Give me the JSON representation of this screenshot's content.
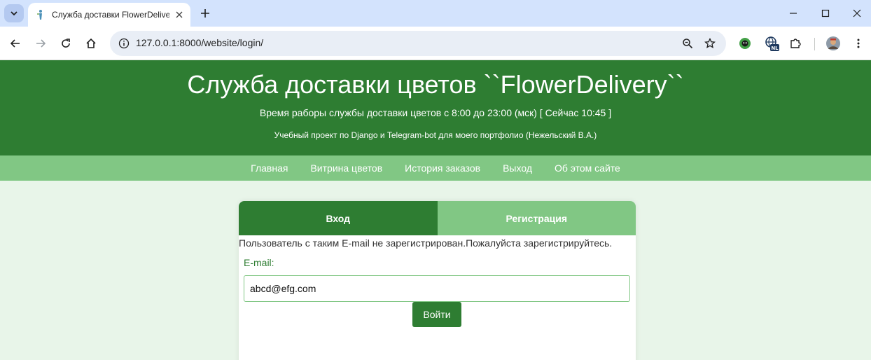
{
  "browser": {
    "tab_title": "Служба доставки FlowerDelivery",
    "url": "127.0.0.1:8000/website/login/",
    "extension_badge": "NL"
  },
  "header": {
    "title": "Служба доставки цветов ``FlowerDelivery``",
    "hours": "Время раборы службы доставки цветов с 8:00 до 23:00 (мск) [ Сейчас 10:45 ]",
    "note": "Учебный проект по Django и Telegram-bot для моего портфолио (Нежельский В.А.)"
  },
  "nav": {
    "items": [
      {
        "label": "Главная"
      },
      {
        "label": "Витрина цветов"
      },
      {
        "label": "История заказов"
      },
      {
        "label": "Выход"
      },
      {
        "label": "Об этом сайте"
      }
    ]
  },
  "auth": {
    "tabs": [
      {
        "label": "Вход",
        "active": true
      },
      {
        "label": "Регистрация",
        "active": false
      }
    ],
    "message": "Пользователь с таким E-mail не зарегистрирован.Пожалуйста зарегистрируйтесь.",
    "email_label": "E-mail:",
    "email_value": "abcd@efg.com",
    "submit_label": "Войти"
  },
  "colors": {
    "primary": "#2e7d32",
    "secondary": "#81c784",
    "background": "#e8f5e9"
  }
}
